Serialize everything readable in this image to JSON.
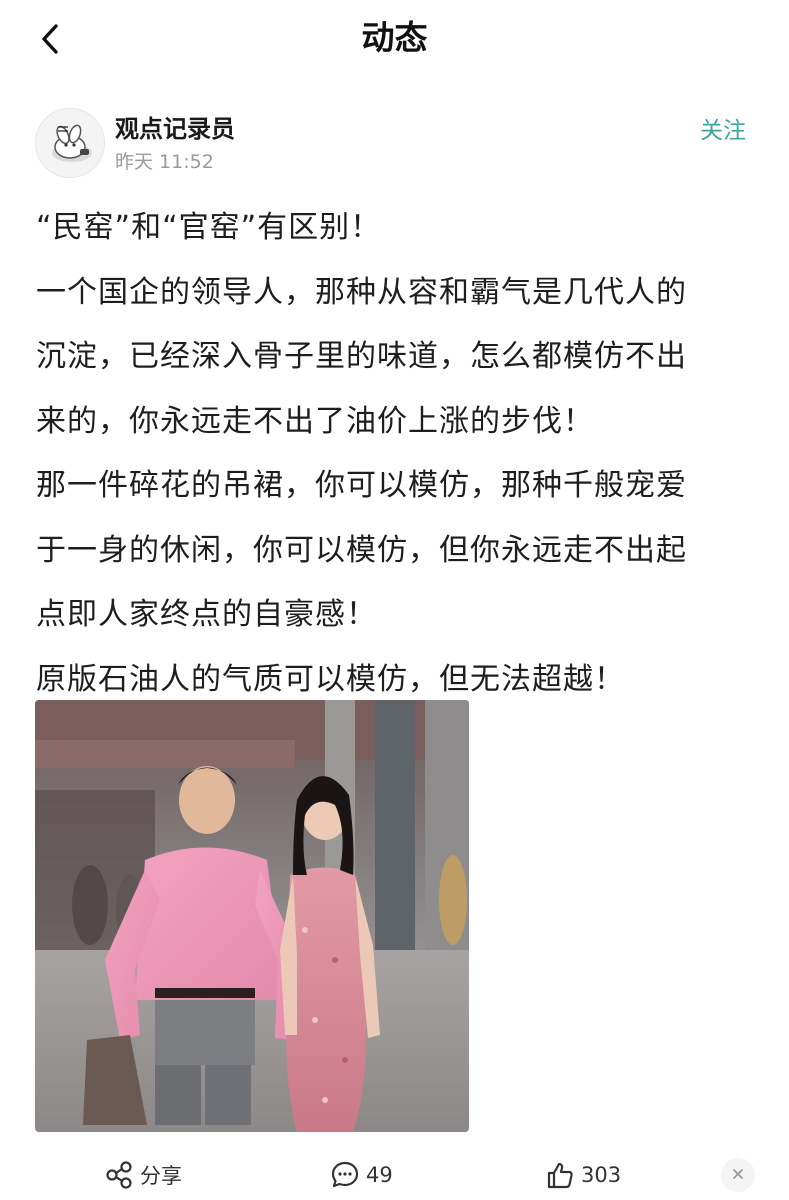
{
  "header": {
    "title": "动态",
    "back_icon": "chevron-left-icon"
  },
  "author": {
    "name": "观点记录员",
    "time": "昨天 11:52",
    "follow_label": "关注",
    "follow_color": "#3fa3a1",
    "avatar_icon": "rabbit-avatar"
  },
  "post": {
    "lines": [
      "“民窑”和“官窑”有区别！",
      "一个国企的领导人，那种从容和霸气是几代人的",
      "沉淀，已经深入骨子里的味道，怎么都模仿不出",
      "来的，你永远走不出了油价上涨的步伐！",
      "那一件碎花的吊裙，你可以模仿，那种千般宠爱",
      "于一身的休闲，你可以模仿，但你永远走不出起",
      "点即人家终点的自豪感！",
      "原版石油人的气质可以模仿，但无法超越！"
    ],
    "image_description_icon": "photo-couple-walking"
  },
  "actions": {
    "share_label": "分享",
    "share_icon": "share-icon",
    "comment_count": "49",
    "comment_icon": "comment-icon",
    "like_count": "303",
    "like_icon": "thumbs-up-icon",
    "close_icon": "close-icon"
  }
}
